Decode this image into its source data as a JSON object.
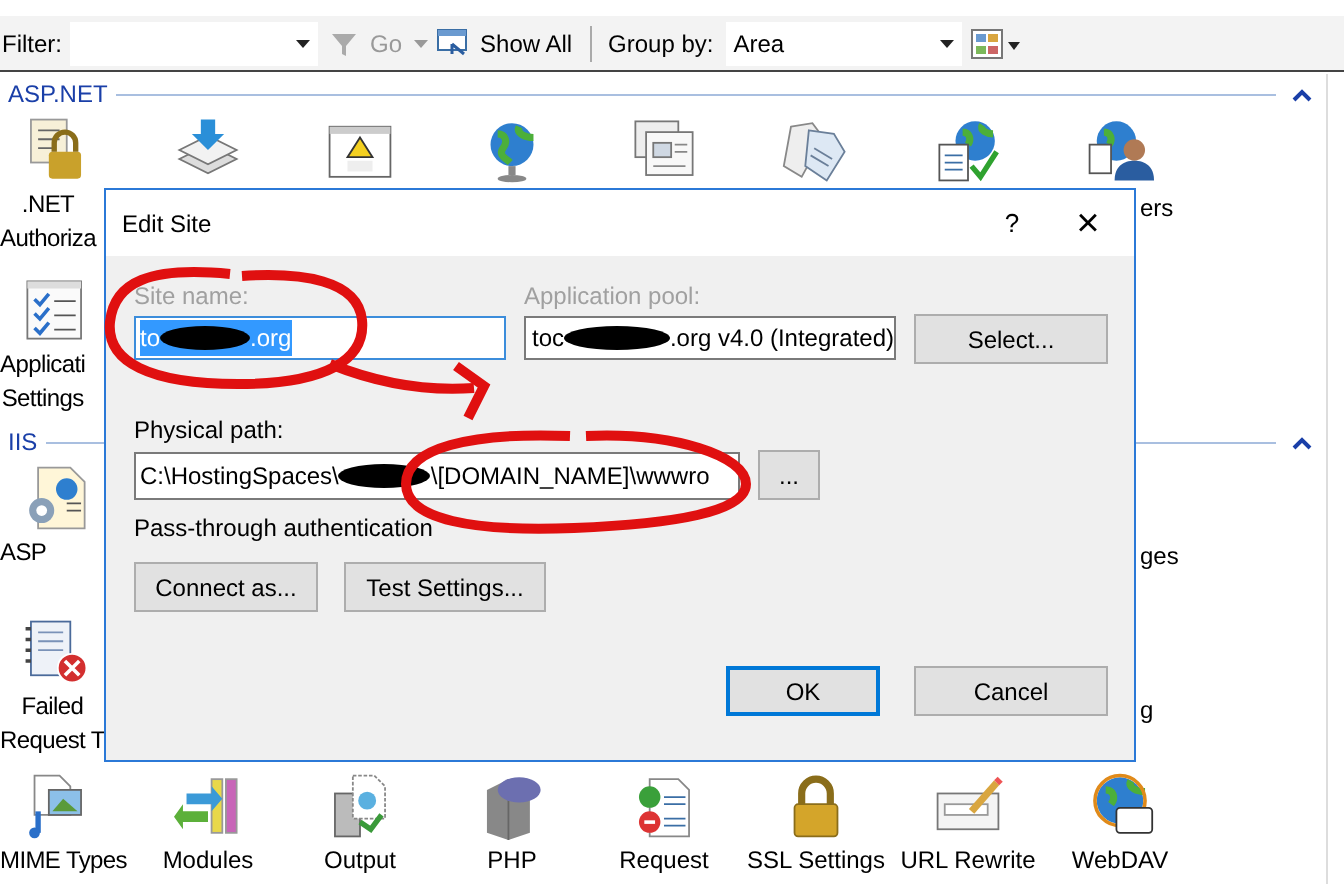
{
  "toolbar": {
    "filter_label": "Filter:",
    "go": {
      "label": "Go",
      "disabled": true
    },
    "show_all": "Show All",
    "group_by_label": "Group by:",
    "group_by_value": "Area"
  },
  "groups": [
    {
      "title": "ASP.NET",
      "expanded": true,
      "rows": [
        {
          "cells": [
            {
              "kind": "lock-doc",
              "label": [
                ".NET",
                "Authoriza"
              ]
            },
            {
              "kind": "download"
            },
            {
              "kind": "error-page"
            },
            {
              "kind": "globe"
            },
            {
              "kind": "screens"
            },
            {
              "kind": "tags"
            },
            {
              "kind": "globe-check"
            },
            {
              "kind": "globe-user",
              "label": [
                "ers"
              ]
            }
          ]
        },
        {
          "cells": [
            {
              "kind": "checklist",
              "label": [
                "Applicati",
                "Settings"
              ]
            }
          ]
        }
      ]
    },
    {
      "title": "IIS",
      "expanded": true,
      "rows": [
        {
          "cells": [
            {
              "kind": "asp-page",
              "label": [
                "ASP"
              ]
            },
            {
              "label": [
                "ges"
              ]
            }
          ]
        },
        {
          "cells": [
            {
              "kind": "failed-log",
              "label": [
                "Failed",
                "Request T"
              ]
            },
            {
              "label": [
                "g"
              ]
            }
          ]
        },
        {
          "cells": [
            {
              "kind": "mime",
              "label": [
                "MIME Types"
              ]
            },
            {
              "kind": "modules",
              "label": [
                "Modules"
              ]
            },
            {
              "kind": "server",
              "label": [
                "Output"
              ]
            },
            {
              "kind": "php",
              "label": [
                "PHP"
              ]
            },
            {
              "kind": "filter-doc",
              "label": [
                "Request"
              ]
            },
            {
              "kind": "padlock",
              "label": [
                "SSL Settings"
              ]
            },
            {
              "kind": "url-page",
              "label": [
                "URL Rewrite"
              ]
            },
            {
              "kind": "webdav",
              "label": [
                "WebDAV"
              ]
            }
          ]
        }
      ]
    }
  ],
  "dialog": {
    "title": "Edit Site",
    "help": "?",
    "close": "×",
    "site_name": {
      "label": "Site name:",
      "disabled": true,
      "value_start": "to",
      "value_end": ".org",
      "selected": true
    },
    "app_pool": {
      "label": "Application pool:",
      "disabled": true,
      "value_start": "toc",
      "value_end": ".org v4.0 (Integrated)"
    },
    "select_button": "Select...",
    "physical_path": {
      "label": "Physical path:",
      "value_start": "C:\\HostingSpaces\\",
      "value_end": "\\[DOMAIN_NAME]\\wwwro"
    },
    "browse_button": "...",
    "auth_text": "Pass-through authentication",
    "connect_button": "Connect as...",
    "test_button": "Test Settings...",
    "ok_button": "OK",
    "cancel_button": "Cancel"
  }
}
